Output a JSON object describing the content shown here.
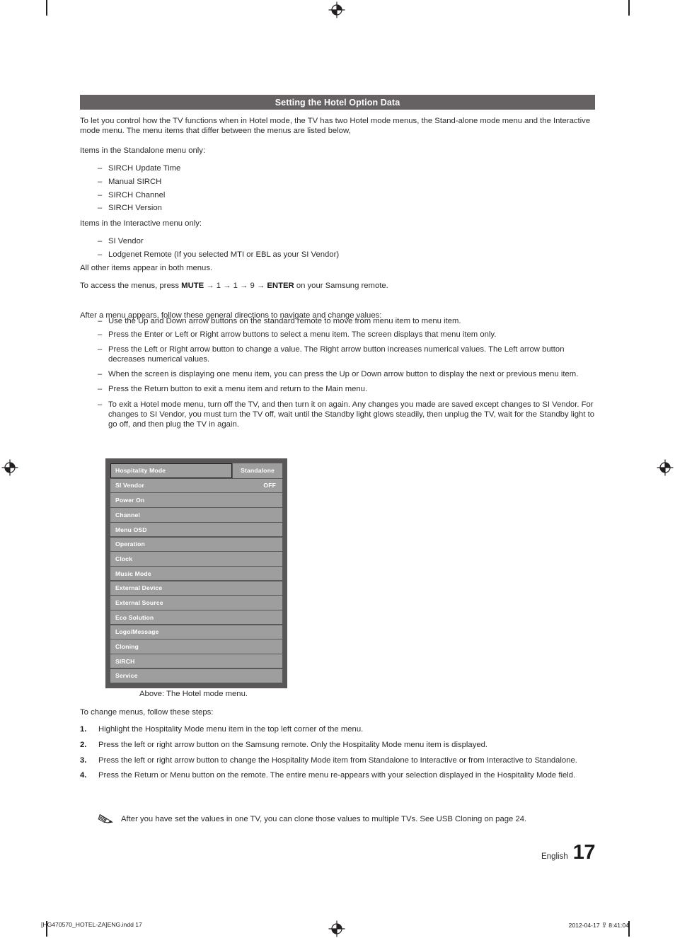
{
  "section": {
    "title": "Setting the Hotel Option Data"
  },
  "intro": {
    "paragraph1": "To let you control how the TV functions when in Hotel mode, the TV has two Hotel mode menus, the Stand-alone mode menu and the Interactive mode menu. The menu items that differ between the menus are listed below,",
    "standalone_heading": "Items in the Standalone menu only:",
    "standalone_items": [
      "SIRCH Update Time",
      "Manual SIRCH",
      "SIRCH Channel",
      "SIRCH Version"
    ],
    "interactive_heading": "Items in the Interactive menu only:",
    "interactive_items": [
      "SI Vendor",
      "Lodgenet Remote (If you selected MTI or EBL as your SI Vendor)"
    ],
    "both_menus_note": "All other items appear in both menus."
  },
  "access": {
    "prefix": "To access the menus, press ",
    "key_mute": "MUTE",
    "arrow": " → ",
    "key_1a": "1",
    "key_1b": "1",
    "key_9": "9",
    "key_enter": "ENTER",
    "suffix": " on your Samsung remote.",
    "directions_heading": "After a menu appears, follow these general directions to navigate and change values:",
    "directions": [
      "Use the Up and Down arrow buttons on the standard remote to move from menu item to menu item.",
      "Press the Enter or Left or Right arrow buttons to select a menu item. The screen displays that menu item only.",
      "Press the Left or Right arrow button to change a value. The Right arrow button increases numerical values. The Left arrow button decreases numerical values.",
      "When the screen is displaying one menu item, you can press the Up or Down arrow button to display the next or previous menu item.",
      "Press the Return button to exit a menu item and return to the Main menu.",
      "To exit a Hotel mode menu, turn off the TV, and then turn it on again. Any changes you made are saved except changes to SI Vendor. For changes to SI Vendor, you must turn the TV off, wait until the Standby light glows steadily, then unplug the TV, wait for the Standby light to go off, and then plug the TV in again."
    ]
  },
  "tv_menu": {
    "rows": [
      {
        "label": "Hospitality Mode",
        "value": "Standalone",
        "highlighted": true
      },
      {
        "label": "SI Vendor",
        "value": "OFF",
        "highlighted": false
      },
      {
        "label": "Power On",
        "value": "",
        "highlighted": false
      },
      {
        "label": "Channel",
        "value": "",
        "highlighted": false
      },
      {
        "label": "Menu OSD",
        "value": "",
        "highlighted": false
      },
      {
        "label": "Operation",
        "value": "",
        "highlighted": false
      },
      {
        "label": "Clock",
        "value": "",
        "highlighted": false
      },
      {
        "label": "Music Mode",
        "value": "",
        "highlighted": false
      },
      {
        "label": "External Device",
        "value": "",
        "highlighted": false
      },
      {
        "label": "External Source",
        "value": "",
        "highlighted": false
      },
      {
        "label": "Eco Solution",
        "value": "",
        "highlighted": false
      },
      {
        "label": "Logo/Message",
        "value": "",
        "highlighted": false
      },
      {
        "label": "Cloning",
        "value": "",
        "highlighted": false
      },
      {
        "label": "SIRCH",
        "value": "",
        "highlighted": false
      },
      {
        "label": "Service",
        "value": "",
        "highlighted": false
      }
    ],
    "caption": "Above: The Hotel mode menu.",
    "panel_color": "#595757",
    "row_color": "#9e9e9e",
    "highlight_border_color": "#231f20"
  },
  "steps": {
    "heading": "To change menus, follow these steps:",
    "items": [
      {
        "num": "1.",
        "text": "Highlight the Hospitality Mode menu item in the top left corner of the menu."
      },
      {
        "num": "2.",
        "text": "Press the left or right arrow button on the Samsung remote. Only the Hospitality Mode menu item is displayed."
      },
      {
        "num": "3.",
        "text": "Press the left or right arrow button to change the Hospitality Mode item from Standalone to Interactive or from Interactive to Standalone."
      },
      {
        "num": "4.",
        "text": "Press the Return or Menu button on the remote. The entire menu re-appears with your selection displayed in the Hospitality Mode field."
      }
    ],
    "note": "After you have set the values in one TV, you can clone those values to multiple TVs. See USB Cloning on page 24."
  },
  "footer": {
    "language": "English",
    "page_number": "17",
    "file_name": "[HG470570_HOTEL-ZA]ENG.indd   17",
    "timestamp": "2012-04-17   ㅱ 8:41:04"
  }
}
